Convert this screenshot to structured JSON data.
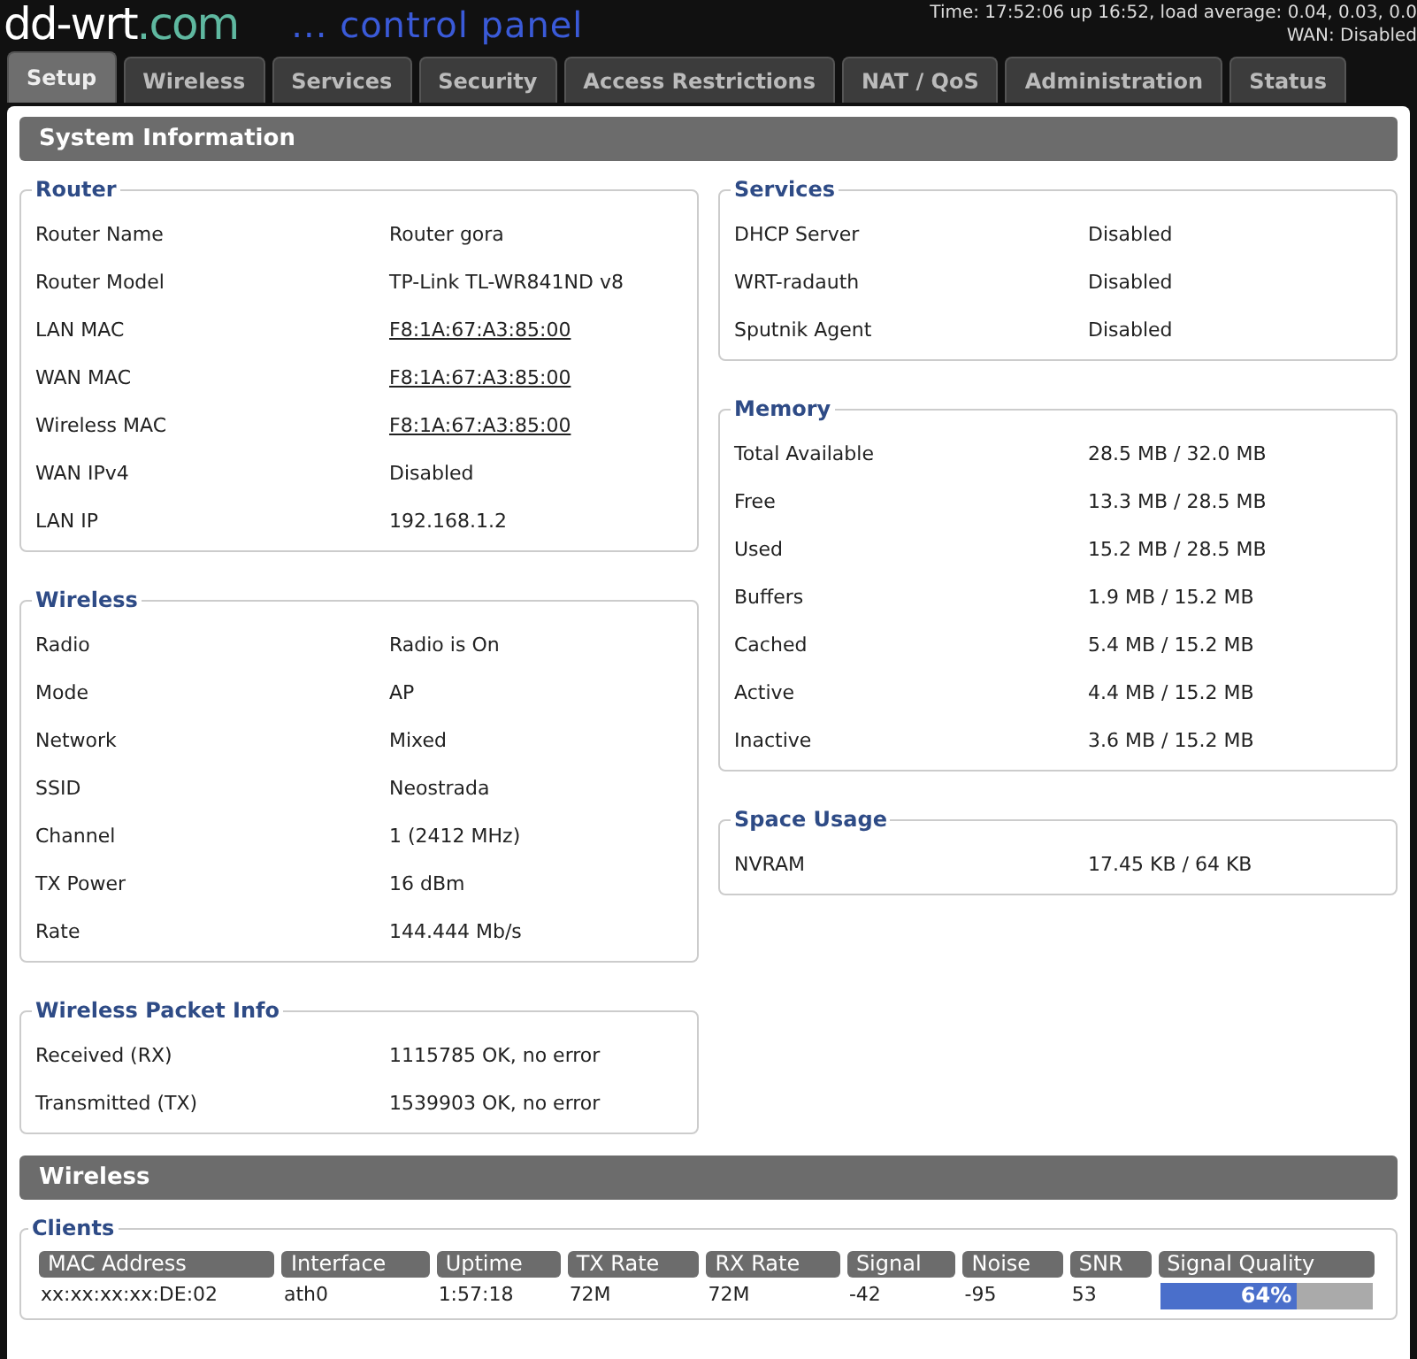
{
  "header": {
    "logo_main": "dd-wrt",
    "logo_domain": ".com",
    "tagline": "... control panel",
    "status_lines": [
      "Time: 17:52:06 up 16:52, load average: 0.04, 0.03, 0.0",
      "WAN: Disabled"
    ]
  },
  "tabs": [
    {
      "label": "Setup",
      "selected": true
    },
    {
      "label": "Wireless",
      "selected": false
    },
    {
      "label": "Services",
      "selected": false
    },
    {
      "label": "Security",
      "selected": false
    },
    {
      "label": "Access Restrictions",
      "selected": false
    },
    {
      "label": "NAT / QoS",
      "selected": false
    },
    {
      "label": "Administration",
      "selected": false
    },
    {
      "label": "Status",
      "selected": false
    }
  ],
  "system_information": {
    "title": "System Information",
    "left": [
      {
        "legend": "Router",
        "rows": [
          {
            "label": "Router Name",
            "value": "Router gora",
            "link": false
          },
          {
            "label": "Router Model",
            "value": "TP-Link TL-WR841ND v8",
            "link": false
          },
          {
            "label": "LAN MAC",
            "value": "F8:1A:67:A3:85:00",
            "link": true
          },
          {
            "label": "WAN MAC",
            "value": "F8:1A:67:A3:85:00",
            "link": true
          },
          {
            "label": "Wireless MAC",
            "value": "F8:1A:67:A3:85:00",
            "link": true
          },
          {
            "label": "WAN IPv4",
            "value": "Disabled",
            "link": false
          },
          {
            "label": "LAN IP",
            "value": "192.168.1.2",
            "link": false
          }
        ]
      },
      {
        "legend": "Wireless",
        "rows": [
          {
            "label": "Radio",
            "value": "Radio is On",
            "link": false
          },
          {
            "label": "Mode",
            "value": "AP",
            "link": false
          },
          {
            "label": "Network",
            "value": "Mixed",
            "link": false
          },
          {
            "label": "SSID",
            "value": "Neostrada",
            "link": false
          },
          {
            "label": "Channel",
            "value": "1 (2412 MHz)",
            "link": false
          },
          {
            "label": "TX Power",
            "value": "16 dBm",
            "link": false
          },
          {
            "label": "Rate",
            "value": "144.444 Mb/s",
            "link": false
          }
        ]
      },
      {
        "legend": "Wireless Packet Info",
        "rows": [
          {
            "label": "Received (RX)",
            "value": "1115785 OK, no error",
            "link": false
          },
          {
            "label": "Transmitted (TX)",
            "value": "1539903 OK, no error",
            "link": false
          }
        ]
      }
    ],
    "right": [
      {
        "legend": "Services",
        "rows": [
          {
            "label": "DHCP Server",
            "value": "Disabled",
            "link": false
          },
          {
            "label": "WRT-radauth",
            "value": "Disabled",
            "link": false
          },
          {
            "label": "Sputnik Agent",
            "value": "Disabled",
            "link": false
          }
        ]
      },
      {
        "legend": "Memory",
        "rows": [
          {
            "label": "Total Available",
            "value": "28.5 MB / 32.0 MB",
            "link": false
          },
          {
            "label": "Free",
            "value": "13.3 MB / 28.5 MB",
            "link": false
          },
          {
            "label": "Used",
            "value": "15.2 MB / 28.5 MB",
            "link": false
          },
          {
            "label": "Buffers",
            "value": "1.9 MB / 15.2 MB",
            "link": false
          },
          {
            "label": "Cached",
            "value": "5.4 MB / 15.2 MB",
            "link": false
          },
          {
            "label": "Active",
            "value": "4.4 MB / 15.2 MB",
            "link": false
          },
          {
            "label": "Inactive",
            "value": "3.6 MB / 15.2 MB",
            "link": false
          }
        ]
      },
      {
        "legend": "Space Usage",
        "rows": [
          {
            "label": "NVRAM",
            "value": "17.45 KB / 64 KB",
            "link": false
          }
        ]
      }
    ]
  },
  "wireless": {
    "title": "Wireless",
    "clients": {
      "legend": "Clients",
      "columns": [
        "MAC Address",
        "Interface",
        "Uptime",
        "TX Rate",
        "RX Rate",
        "Signal",
        "Noise",
        "SNR",
        "Signal Quality"
      ],
      "rows": [
        {
          "mac": "xx:xx:xx:xx:DE:02",
          "interface": "ath0",
          "uptime": "1:57:18",
          "tx_rate": "72M",
          "rx_rate": "72M",
          "signal": "-42",
          "noise": "-95",
          "snr": "53",
          "quality": "64%",
          "level": 0.64
        }
      ]
    }
  }
}
